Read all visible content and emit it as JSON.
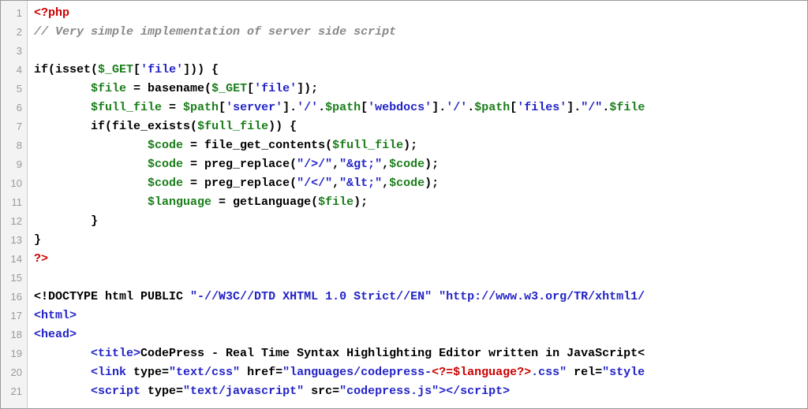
{
  "editor": {
    "line_numbers": [
      "1",
      "2",
      "3",
      "4",
      "5",
      "6",
      "7",
      "8",
      "9",
      "10",
      "11",
      "12",
      "13",
      "14",
      "15",
      "16",
      "17",
      "18",
      "19",
      "20",
      "21"
    ],
    "lines": [
      {
        "indent": "",
        "tokens": [
          {
            "cls": "tok-php-open",
            "text": "<?php"
          }
        ]
      },
      {
        "indent": "",
        "tokens": [
          {
            "cls": "tok-comment",
            "text": "// Very simple implementation of server side script"
          }
        ]
      },
      {
        "indent": "",
        "tokens": []
      },
      {
        "indent": "",
        "tokens": [
          {
            "cls": "tok-keyword",
            "text": "if"
          },
          {
            "cls": "tok-plain",
            "text": "(isset("
          },
          {
            "cls": "tok-var",
            "text": "$_GET"
          },
          {
            "cls": "tok-plain",
            "text": "["
          },
          {
            "cls": "tok-string",
            "text": "'file'"
          },
          {
            "cls": "tok-plain",
            "text": "])) {"
          }
        ]
      },
      {
        "indent": "        ",
        "tokens": [
          {
            "cls": "tok-var",
            "text": "$file"
          },
          {
            "cls": "tok-plain",
            "text": " = basename("
          },
          {
            "cls": "tok-var",
            "text": "$_GET"
          },
          {
            "cls": "tok-plain",
            "text": "["
          },
          {
            "cls": "tok-string",
            "text": "'file'"
          },
          {
            "cls": "tok-plain",
            "text": "]);"
          }
        ]
      },
      {
        "indent": "        ",
        "tokens": [
          {
            "cls": "tok-var",
            "text": "$full_file"
          },
          {
            "cls": "tok-plain",
            "text": " = "
          },
          {
            "cls": "tok-var",
            "text": "$path"
          },
          {
            "cls": "tok-plain",
            "text": "["
          },
          {
            "cls": "tok-string",
            "text": "'server'"
          },
          {
            "cls": "tok-plain",
            "text": "]."
          },
          {
            "cls": "tok-string",
            "text": "'/'"
          },
          {
            "cls": "tok-plain",
            "text": "."
          },
          {
            "cls": "tok-var",
            "text": "$path"
          },
          {
            "cls": "tok-plain",
            "text": "["
          },
          {
            "cls": "tok-string",
            "text": "'webdocs'"
          },
          {
            "cls": "tok-plain",
            "text": "]."
          },
          {
            "cls": "tok-string",
            "text": "'/'"
          },
          {
            "cls": "tok-plain",
            "text": "."
          },
          {
            "cls": "tok-var",
            "text": "$path"
          },
          {
            "cls": "tok-plain",
            "text": "["
          },
          {
            "cls": "tok-string",
            "text": "'files'"
          },
          {
            "cls": "tok-plain",
            "text": "]."
          },
          {
            "cls": "tok-string",
            "text": "\"/\""
          },
          {
            "cls": "tok-plain",
            "text": "."
          },
          {
            "cls": "tok-var",
            "text": "$file"
          }
        ]
      },
      {
        "indent": "        ",
        "tokens": [
          {
            "cls": "tok-keyword",
            "text": "if"
          },
          {
            "cls": "tok-plain",
            "text": "(file_exists("
          },
          {
            "cls": "tok-var",
            "text": "$full_file"
          },
          {
            "cls": "tok-plain",
            "text": ")) {"
          }
        ]
      },
      {
        "indent": "                ",
        "tokens": [
          {
            "cls": "tok-var",
            "text": "$code"
          },
          {
            "cls": "tok-plain",
            "text": " = file_get_contents("
          },
          {
            "cls": "tok-var",
            "text": "$full_file"
          },
          {
            "cls": "tok-plain",
            "text": ");"
          }
        ]
      },
      {
        "indent": "                ",
        "tokens": [
          {
            "cls": "tok-var",
            "text": "$code"
          },
          {
            "cls": "tok-plain",
            "text": " = preg_replace("
          },
          {
            "cls": "tok-string",
            "text": "\"/>/\""
          },
          {
            "cls": "tok-plain",
            "text": ","
          },
          {
            "cls": "tok-string",
            "text": "\"&gt;\""
          },
          {
            "cls": "tok-plain",
            "text": ","
          },
          {
            "cls": "tok-var",
            "text": "$code"
          },
          {
            "cls": "tok-plain",
            "text": ");"
          }
        ]
      },
      {
        "indent": "                ",
        "tokens": [
          {
            "cls": "tok-var",
            "text": "$code"
          },
          {
            "cls": "tok-plain",
            "text": " = preg_replace("
          },
          {
            "cls": "tok-string",
            "text": "\"/</\""
          },
          {
            "cls": "tok-plain",
            "text": ","
          },
          {
            "cls": "tok-string",
            "text": "\"&lt;\""
          },
          {
            "cls": "tok-plain",
            "text": ","
          },
          {
            "cls": "tok-var",
            "text": "$code"
          },
          {
            "cls": "tok-plain",
            "text": ");"
          }
        ]
      },
      {
        "indent": "                ",
        "tokens": [
          {
            "cls": "tok-var",
            "text": "$language"
          },
          {
            "cls": "tok-plain",
            "text": " = getLanguage("
          },
          {
            "cls": "tok-var",
            "text": "$file"
          },
          {
            "cls": "tok-plain",
            "text": ");"
          }
        ]
      },
      {
        "indent": "        ",
        "tokens": [
          {
            "cls": "tok-plain",
            "text": "}"
          }
        ]
      },
      {
        "indent": "",
        "tokens": [
          {
            "cls": "tok-plain",
            "text": "}"
          }
        ]
      },
      {
        "indent": "",
        "tokens": [
          {
            "cls": "tok-php-close",
            "text": "?>"
          }
        ]
      },
      {
        "indent": "",
        "tokens": []
      },
      {
        "indent": "",
        "tokens": [
          {
            "cls": "tok-plain",
            "text": "<!DOCTYPE html PUBLIC "
          },
          {
            "cls": "tok-doctype",
            "text": "\"-//W3C//DTD XHTML 1.0 Strict//EN\" \"http://www.w3.org/TR/xhtml1/"
          }
        ]
      },
      {
        "indent": "",
        "tokens": [
          {
            "cls": "tok-tag",
            "text": "<html>"
          }
        ]
      },
      {
        "indent": "",
        "tokens": [
          {
            "cls": "tok-tag",
            "text": "<head>"
          }
        ]
      },
      {
        "indent": "        ",
        "tokens": [
          {
            "cls": "tok-tag",
            "text": "<title>"
          },
          {
            "cls": "tok-plain",
            "text": "CodePress - Real Time Syntax Highlighting Editor written in JavaScript<"
          }
        ]
      },
      {
        "indent": "        ",
        "tokens": [
          {
            "cls": "tok-tag",
            "text": "<link "
          },
          {
            "cls": "tok-attr",
            "text": "type="
          },
          {
            "cls": "tok-string",
            "text": "\"text/css\""
          },
          {
            "cls": "tok-attr",
            "text": " href="
          },
          {
            "cls": "tok-string",
            "text": "\"languages/codepress-"
          },
          {
            "cls": "tok-php-open",
            "text": "<?=$language?>"
          },
          {
            "cls": "tok-string",
            "text": ".css\""
          },
          {
            "cls": "tok-attr",
            "text": " rel="
          },
          {
            "cls": "tok-string",
            "text": "\"style"
          }
        ]
      },
      {
        "indent": "        ",
        "tokens": [
          {
            "cls": "tok-tag",
            "text": "<script "
          },
          {
            "cls": "tok-attr",
            "text": "type="
          },
          {
            "cls": "tok-string",
            "text": "\"text/javascript\""
          },
          {
            "cls": "tok-attr",
            "text": " src="
          },
          {
            "cls": "tok-string",
            "text": "\"codepress.js\""
          },
          {
            "cls": "tok-tag",
            "text": ">"
          },
          {
            "cls": "tok-tag",
            "text": "</script>"
          }
        ]
      }
    ]
  }
}
